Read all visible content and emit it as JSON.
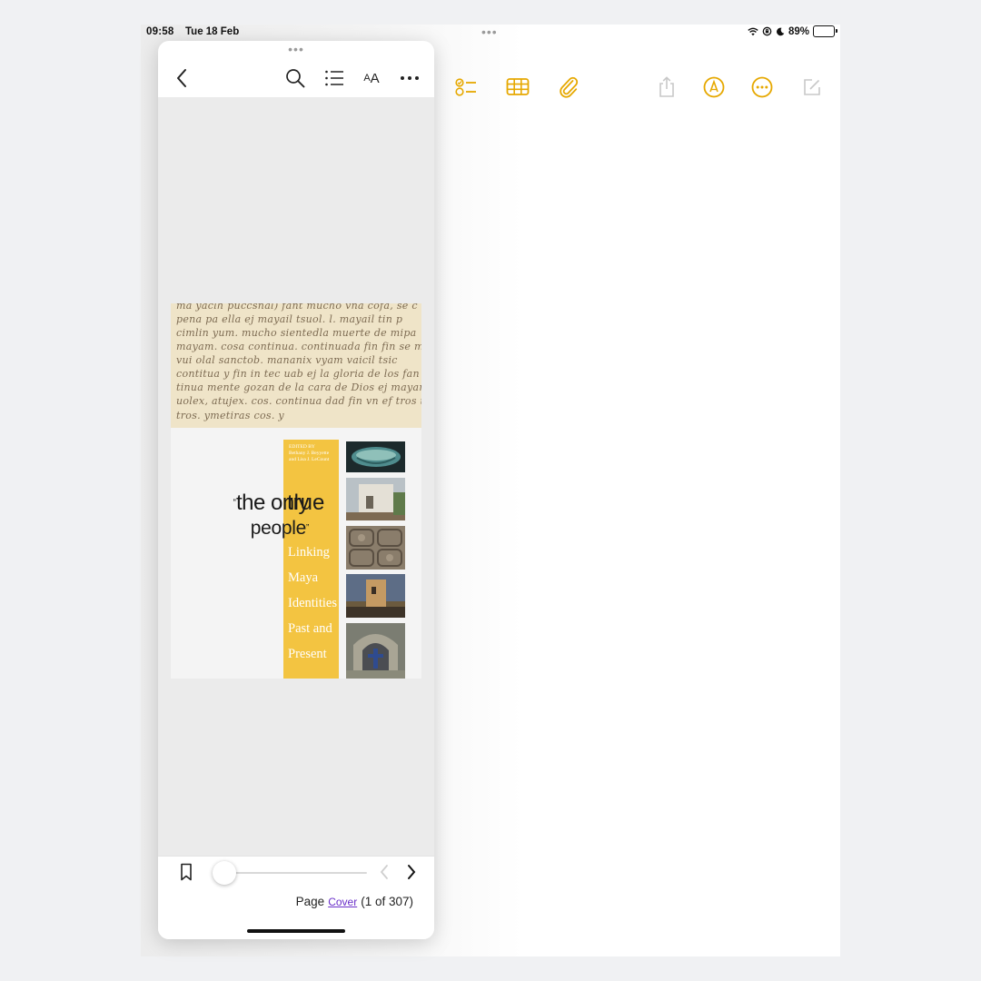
{
  "status_bar": {
    "time": "09:58",
    "date": "Tue 18 Feb",
    "dots": "•••",
    "battery": "89%",
    "battery_level": 0.89
  },
  "notes_toolbar": {
    "accent_color": "#e6a800",
    "disabled_color": "#c8c8c8",
    "icons": [
      "checklist-icon",
      "table-icon",
      "attachment-icon",
      "share-icon",
      "markup-icon",
      "more-icon",
      "compose-icon"
    ]
  },
  "reader": {
    "grabber": "•••",
    "toolbar": {
      "text_size_label_big": "A",
      "text_size_label_small": "A"
    },
    "book": {
      "manuscript_lines": [
        "ma yaclh puccsnal) fant mucho vna cofa, se c",
        "pena pa ella ej mayail tsuol. l. mayail tin p",
        "cimlin yum. mucho sientedla muerte de mipa",
        "mayam. cosa continua. continuada fin fin se m",
        "vui olal sanctob. mananix vyam vaicil tsic",
        "contitua y fin in tec uab ej la gloria de los fan",
        "tinua mente gozan de la cara de Dios ej mayam a",
        "uolex, atujex. cos. continua dad fin vn ef tros tra",
        "tros. ymetiras cos. y"
      ],
      "quote_open": "“",
      "title_line1": "the only",
      "title_line2": "people",
      "quote_close": "”",
      "title_true": "true",
      "editors": "EDITED BY\nBethany J. Beyyette\nand Lisa J. LeCount",
      "subtitle_words": [
        "Linking",
        "Maya",
        "Identities",
        "Past and",
        "Present"
      ]
    },
    "footer": {
      "page_label": "Page",
      "page_link": "Cover",
      "page_count": "(1 of 307)",
      "slider_position": 0
    }
  }
}
